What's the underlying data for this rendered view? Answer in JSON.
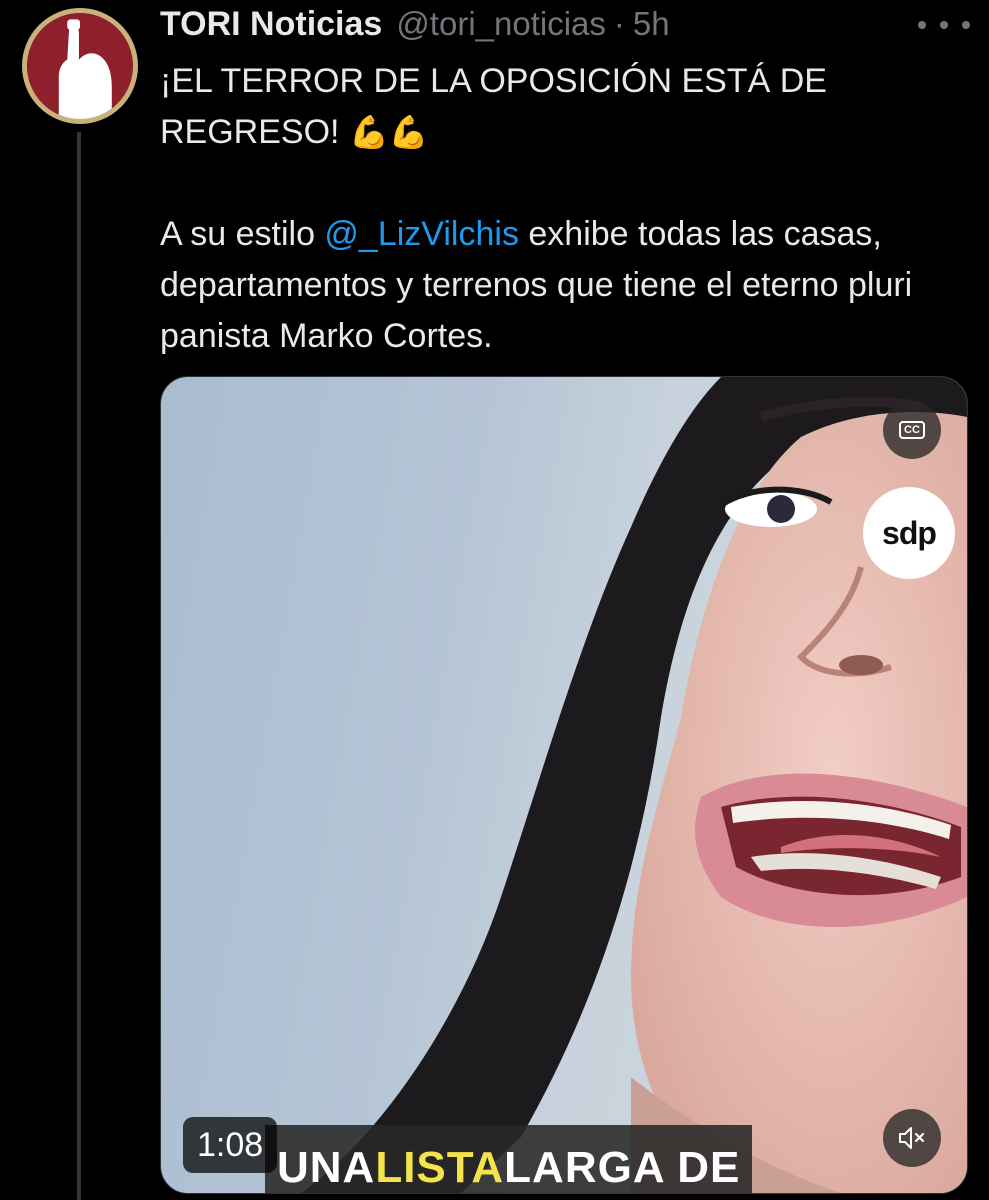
{
  "tweet": {
    "display_name": "TORI Noticias",
    "handle": "@tori_noticias",
    "separator": "·",
    "time": "5h",
    "text_line1": "¡EL TERROR DE LA OPOSICIÓN ESTÁ DE REGRESO!",
    "emoji": "💪💪",
    "text_line2_before": "A su estilo ",
    "mention": "@_LizVilchis",
    "text_line2_after": " exhibe todas las casas, departamentos y terrenos que tiene el eterno pluri panista Marko Cortes."
  },
  "media": {
    "cc_label": "CC",
    "watermark": "sdp",
    "duration": "1:08",
    "caption_word1": "UNA ",
    "caption_word2": "LISTA",
    "caption_word3": " LARGA DE"
  },
  "icons": {
    "avatar": "raised-fist-logo",
    "more": "more-horizontal-icon",
    "cc": "closed-captions-icon",
    "mute": "speaker-muted-icon"
  },
  "colors": {
    "background": "#000000",
    "text": "#e7e9ea",
    "secondary": "#71767b",
    "mention": "#1d9bf0",
    "avatar_bg": "#8e1f2c",
    "caption_highlight": "#f4e44a"
  }
}
